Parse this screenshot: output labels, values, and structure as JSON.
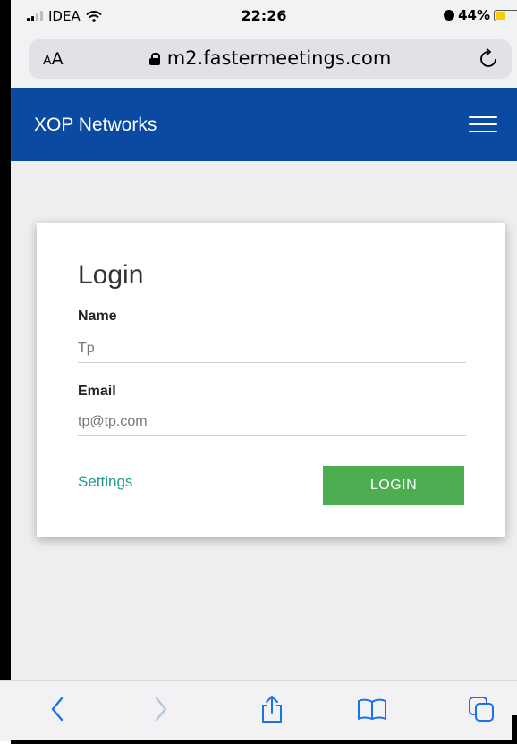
{
  "status_bar": {
    "carrier": "IDEA",
    "time": "22:26",
    "battery": "44%"
  },
  "browser": {
    "text_size_small": "A",
    "text_size_large": "A",
    "url": "m2.fastermeetings.com"
  },
  "header": {
    "brand": "XOP Networks"
  },
  "login": {
    "title": "Login",
    "name_label": "Name",
    "name_value": "Tp",
    "email_label": "Email",
    "email_value": "tp@tp.com",
    "settings_label": "Settings",
    "login_label": "LOGIN"
  },
  "colors": {
    "header_bg": "#0b4aa3",
    "login_button": "#4cae50",
    "link": "#1a9b8a",
    "battery": "#f5d000"
  },
  "icons": {
    "signal": "signal-icon",
    "wifi": "wifi-icon",
    "alarm": "alarm-icon",
    "battery": "battery-icon",
    "lock": "lock-icon",
    "reload": "reload-icon",
    "menu": "hamburger-menu-icon",
    "back": "chevron-left-icon",
    "forward": "chevron-right-icon",
    "share": "share-icon",
    "bookmarks": "book-icon",
    "tabs": "tabs-icon"
  }
}
